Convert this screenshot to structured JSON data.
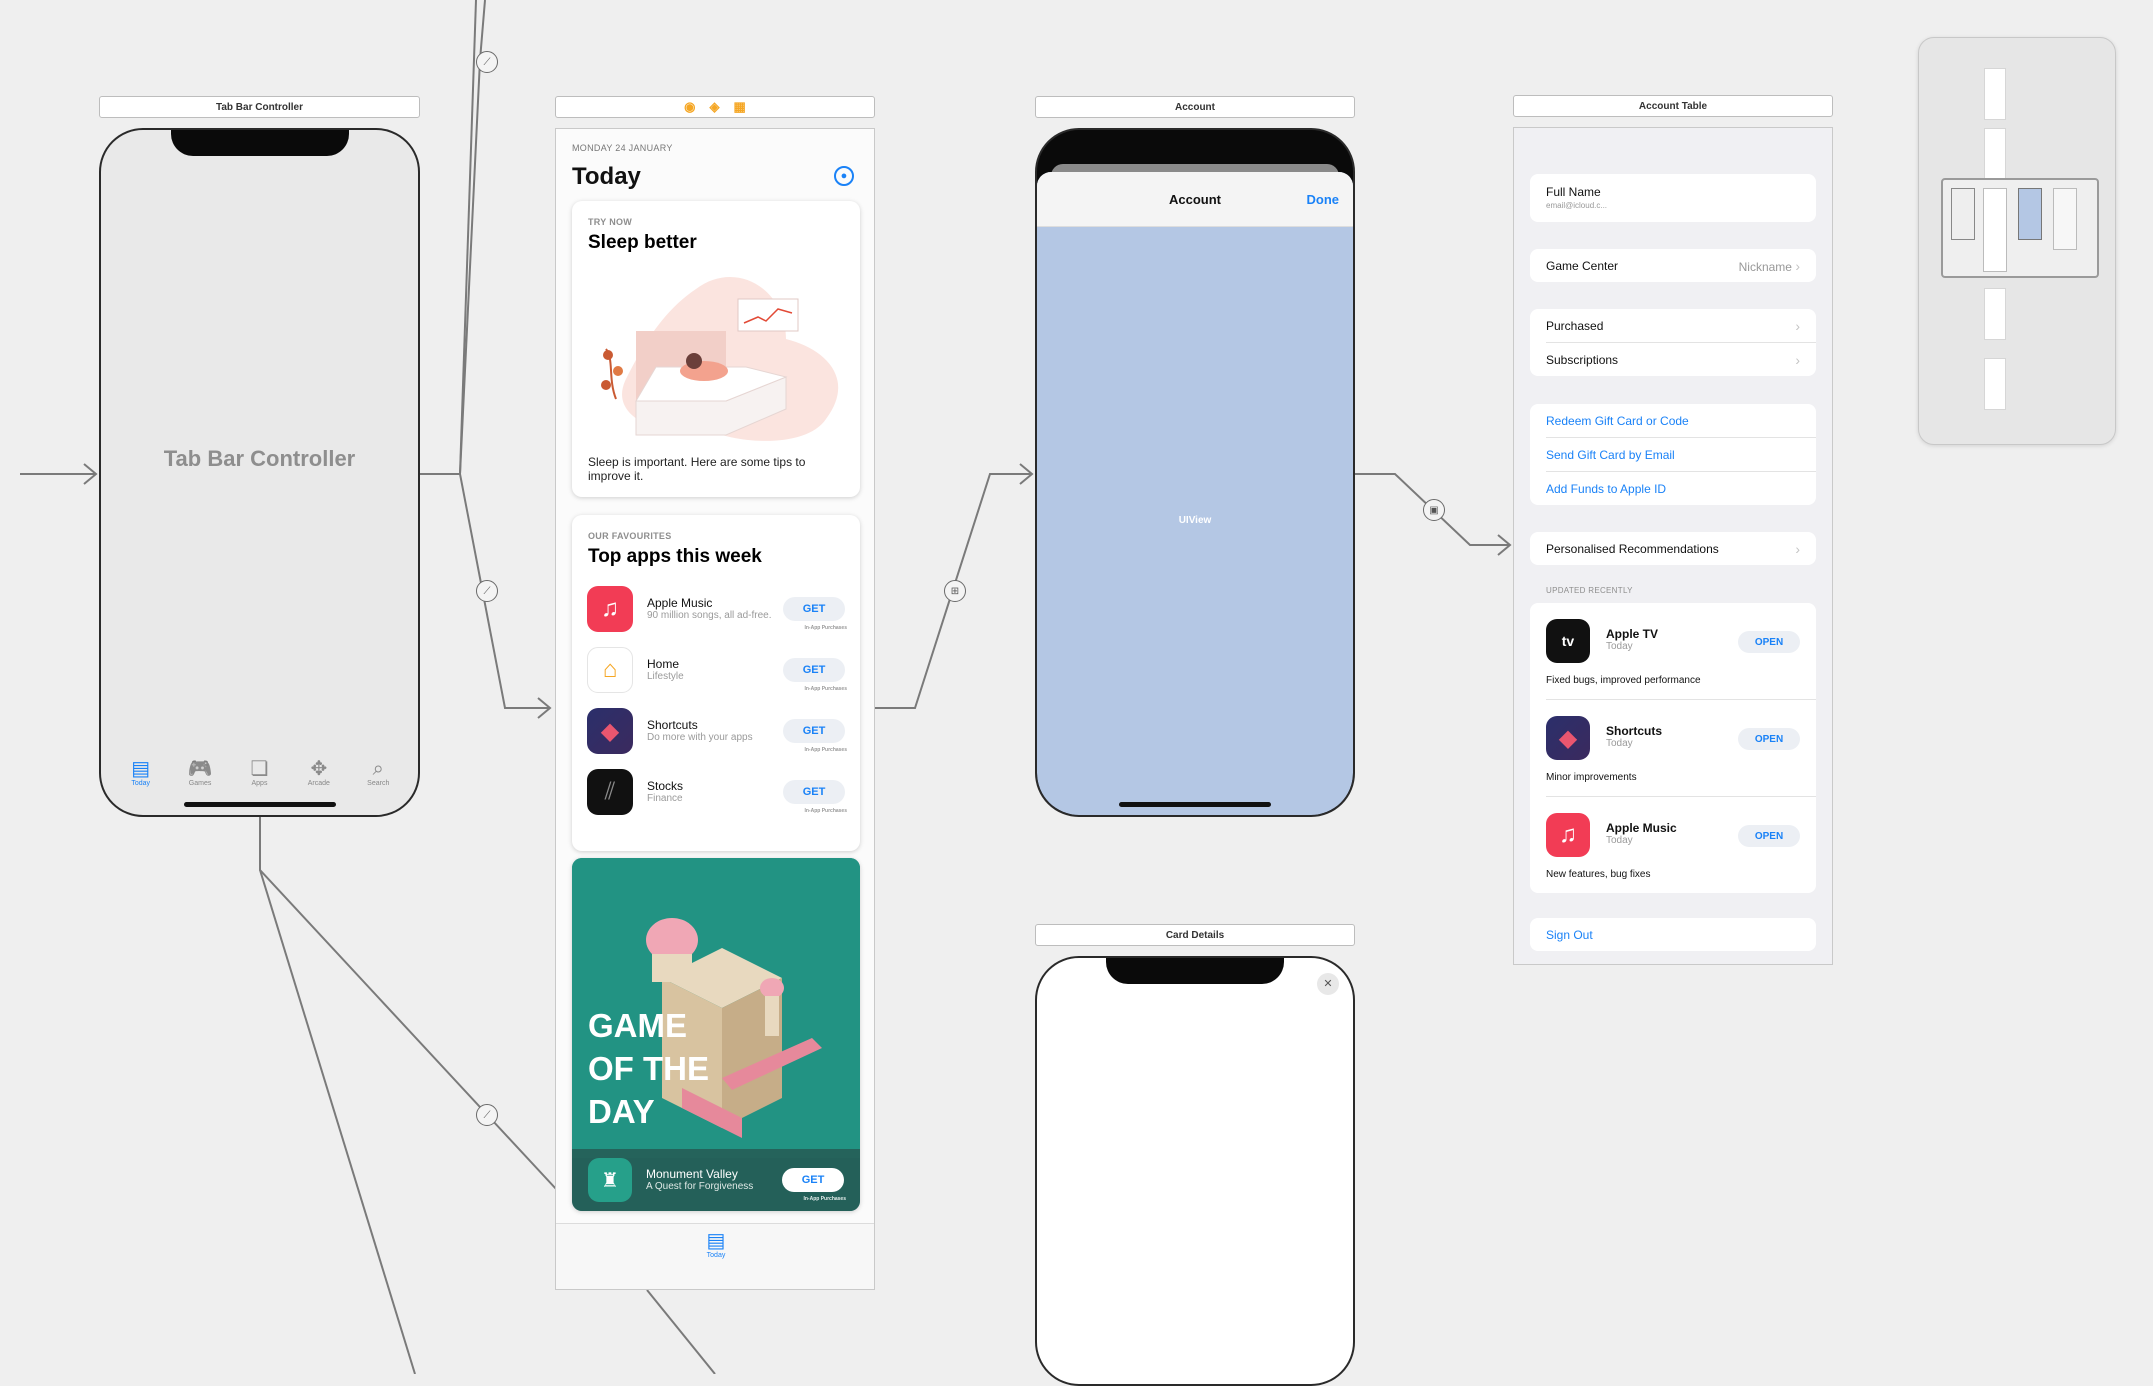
{
  "scenes": {
    "tab_bar_controller": {
      "title": "Tab Bar Controller",
      "label": "Tab Bar Controller",
      "tabs": [
        {
          "label": "Today",
          "icon": "today-icon",
          "glyph": "▤",
          "active": true
        },
        {
          "label": "Games",
          "icon": "gamepad-icon",
          "glyph": "🎮",
          "active": false
        },
        {
          "label": "Apps",
          "icon": "apps-stack-icon",
          "glyph": "❏",
          "active": false
        },
        {
          "label": "Arcade",
          "icon": "arcade-icon",
          "glyph": "✥",
          "active": false
        },
        {
          "label": "Search",
          "icon": "search-icon",
          "glyph": "⌕",
          "active": false
        }
      ]
    },
    "today": {
      "date": "MONDAY 24 JANUARY",
      "title": "Today",
      "card1": {
        "eyebrow": "TRY NOW",
        "title": "Sleep better",
        "caption": "Sleep is important. Here are some tips to improve it."
      },
      "card2": {
        "eyebrow": "OUR FAVOURITES",
        "title": "Top apps this week",
        "apps": [
          {
            "name": "Apple Music",
            "subtitle": "90 million songs, all ad-free.",
            "button": "GET",
            "iap": "In-App Purchases",
            "color": "#f23c55",
            "glyph": "♫",
            "icon": "apple-music-icon"
          },
          {
            "name": "Home",
            "subtitle": "Lifestyle",
            "button": "GET",
            "iap": "In-App Purchases",
            "color": "#ffffff",
            "glyph": "⌂",
            "icon": "home-app-icon"
          },
          {
            "name": "Shortcuts",
            "subtitle": "Do more with your apps",
            "button": "GET",
            "iap": "In-App Purchases",
            "color": "#2f3a7a",
            "glyph": "◆",
            "icon": "shortcuts-icon"
          },
          {
            "name": "Stocks",
            "subtitle": "Finance",
            "button": "GET",
            "iap": "In-App Purchases",
            "color": "#111111",
            "glyph": "⫽",
            "icon": "stocks-icon"
          }
        ]
      },
      "card3": {
        "headline": [
          "GAME",
          "OF THE",
          "DAY"
        ],
        "app_name": "Monument Valley",
        "app_subtitle": "A Quest for Forgiveness",
        "button": "GET",
        "iap": "In-App Purchases"
      },
      "tab_label": "Today"
    },
    "account": {
      "title": "Account",
      "nav_title": "Account",
      "done": "Done",
      "view_label": "UIView"
    },
    "card_details": {
      "title": "Card Details",
      "close": "✕"
    },
    "account_table": {
      "title": "Account Table",
      "full_name": "Full Name",
      "email": "email@icloud.c...",
      "game_center": "Game Center",
      "nickname": "Nickname",
      "purchased": "Purchased",
      "subscriptions": "Subscriptions",
      "links": [
        "Redeem Gift Card or Code",
        "Send Gift Card by Email",
        "Add Funds to Apple ID"
      ],
      "recommendations": "Personalised Recommendations",
      "updated_header": "UPDATED RECENTLY",
      "updates": [
        {
          "name": "Apple TV",
          "date": "Today",
          "button": "OPEN",
          "notes": "Fixed bugs, improved performance",
          "color": "#111111",
          "glyph": "tv",
          "icon": "apple-tv-icon"
        },
        {
          "name": "Shortcuts",
          "date": "Today",
          "button": "OPEN",
          "notes": "Minor improvements",
          "color": "#2f3a7a",
          "glyph": "◆",
          "icon": "shortcuts-icon"
        },
        {
          "name": "Apple Music",
          "date": "Today",
          "button": "OPEN",
          "notes": "New features, bug fixes",
          "color": "#f23c55",
          "glyph": "♫",
          "icon": "apple-music-icon"
        }
      ],
      "sign_out": "Sign Out"
    }
  },
  "colors": {
    "accent": "#1a82f7",
    "canvas": "#efefef",
    "uiview": "#b4c7e4"
  }
}
